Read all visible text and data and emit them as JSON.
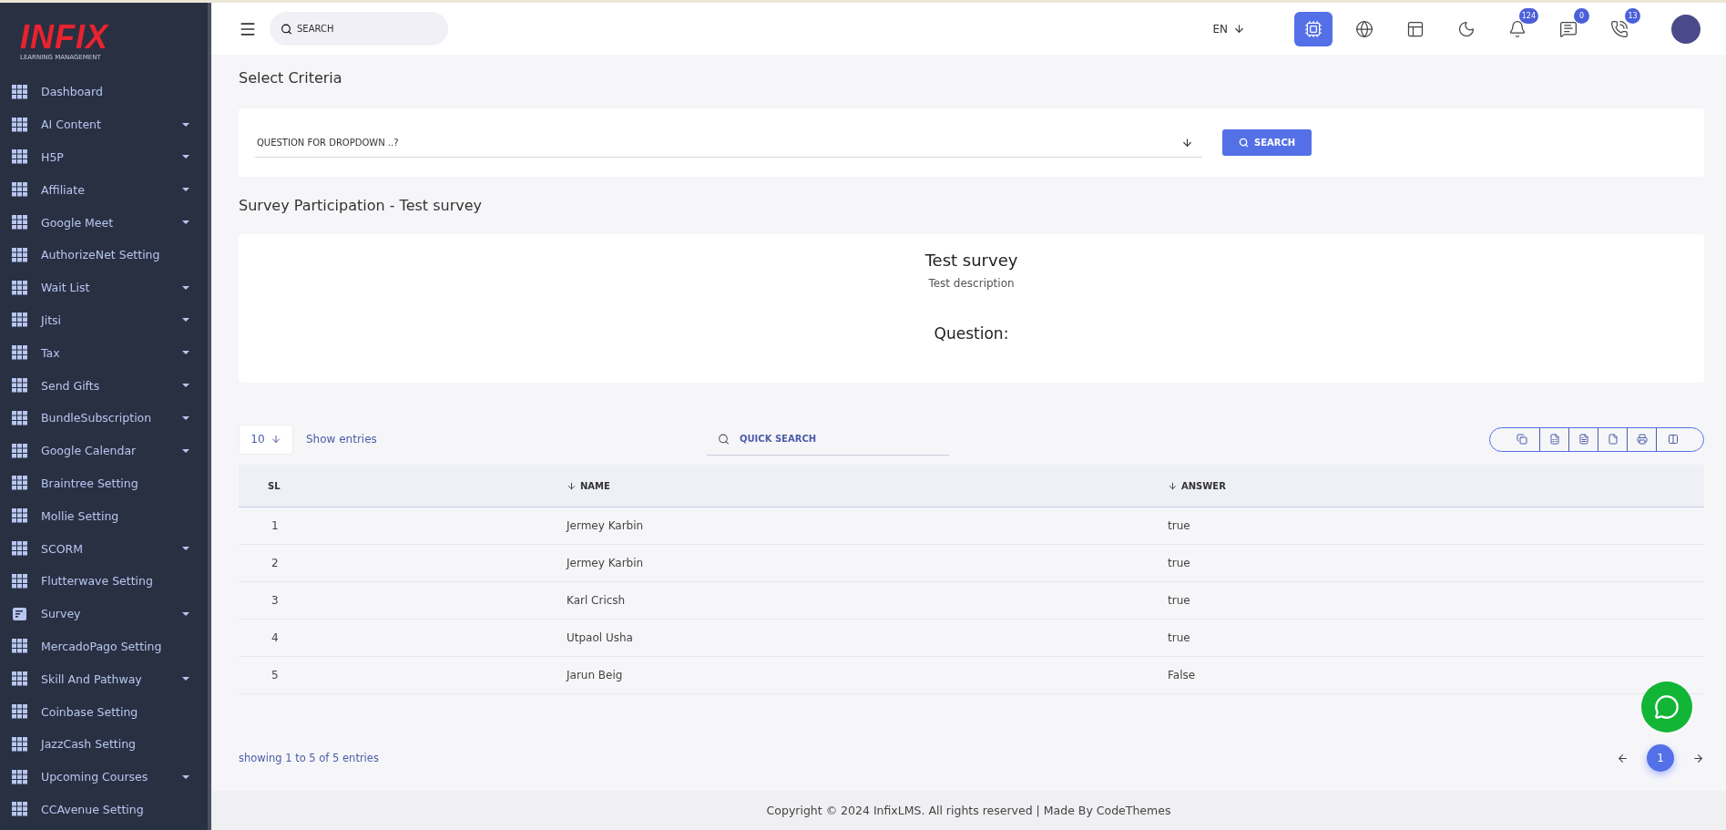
{
  "sidebar": {
    "logo": {
      "brand": "INFIX",
      "tagline": "LEARNING MANAGEMENT"
    },
    "items": [
      {
        "label": "Dashboard",
        "kind": "grid",
        "has_submenu": false
      },
      {
        "label": "AI Content",
        "kind": "grid",
        "has_submenu": true
      },
      {
        "label": "H5P",
        "kind": "grid",
        "has_submenu": true
      },
      {
        "label": "Affiliate",
        "kind": "grid",
        "has_submenu": true
      },
      {
        "label": "Google Meet",
        "kind": "grid",
        "has_submenu": true
      },
      {
        "label": "AuthorizeNet Setting",
        "kind": "grid",
        "has_submenu": false
      },
      {
        "label": "Wait List",
        "kind": "grid",
        "has_submenu": true
      },
      {
        "label": "Jitsi",
        "kind": "grid",
        "has_submenu": true
      },
      {
        "label": "Tax",
        "kind": "grid",
        "has_submenu": true
      },
      {
        "label": "Send Gifts",
        "kind": "grid",
        "has_submenu": true
      },
      {
        "label": "BundleSubscription",
        "kind": "grid",
        "has_submenu": true
      },
      {
        "label": "Google Calendar",
        "kind": "grid",
        "has_submenu": true
      },
      {
        "label": "Braintree Setting",
        "kind": "grid",
        "has_submenu": false
      },
      {
        "label": "Mollie Setting",
        "kind": "grid",
        "has_submenu": false
      },
      {
        "label": "SCORM",
        "kind": "grid",
        "has_submenu": true
      },
      {
        "label": "Flutterwave Setting",
        "kind": "grid",
        "has_submenu": false
      },
      {
        "label": "Survey",
        "kind": "document",
        "has_submenu": true
      },
      {
        "label": "MercadoPago Setting",
        "kind": "grid",
        "has_submenu": false
      },
      {
        "label": "Skill And Pathway",
        "kind": "grid",
        "has_submenu": true
      },
      {
        "label": "Coinbase Setting",
        "kind": "grid",
        "has_submenu": false
      },
      {
        "label": "JazzCash Setting",
        "kind": "grid",
        "has_submenu": false
      },
      {
        "label": "Upcoming Courses",
        "kind": "grid",
        "has_submenu": true
      },
      {
        "label": "CCAvenue Setting",
        "kind": "grid",
        "has_submenu": false
      }
    ]
  },
  "topbar": {
    "search": {
      "placeholder": "SEARCH"
    },
    "language": "EN",
    "icons": [
      {
        "kind": "chip"
      },
      {
        "kind": "globe"
      },
      {
        "kind": "layout"
      },
      {
        "kind": "moon"
      },
      {
        "kind": "bell",
        "badge": "124"
      },
      {
        "kind": "message",
        "badge": "0"
      },
      {
        "kind": "phone",
        "badge": "13"
      }
    ]
  },
  "criteria": {
    "title": "Select Criteria",
    "select": {
      "placeholder": "QUESTION FOR DROPDOWN ..?"
    },
    "button": "SEARCH"
  },
  "survey": {
    "title": "Survey Participation - Test survey",
    "name": "Test survey",
    "description": "Test description",
    "question_label": "Question:"
  },
  "table": {
    "page_size": "10",
    "show_entries": "Show entries",
    "search": {
      "placeholder": "QUICK SEARCH"
    },
    "export_buttons": [
      {
        "kind": "copy"
      },
      {
        "kind": "excel"
      },
      {
        "kind": "csv"
      },
      {
        "kind": "pdf"
      },
      {
        "kind": "print"
      },
      {
        "kind": "columns"
      }
    ],
    "columns": [
      {
        "label": "SL",
        "sortable": false
      },
      {
        "label": "NAME",
        "sortable": true
      },
      {
        "label": "ANSWER",
        "sortable": true
      }
    ],
    "rows": [
      {
        "sl": "1",
        "name": "Jermey Karbin",
        "answer": "true"
      },
      {
        "sl": "2",
        "name": "Jermey Karbin",
        "answer": "true"
      },
      {
        "sl": "3",
        "name": "Karl Cricsh",
        "answer": "true"
      },
      {
        "sl": "4",
        "name": "Utpaol Usha",
        "answer": "true"
      },
      {
        "sl": "5",
        "name": "Jarun Beig",
        "answer": "False"
      }
    ],
    "summary": "showing 1 to 5 of 5 entries",
    "pages": [
      {
        "label": "1",
        "selected": true
      }
    ]
  },
  "footer": "Copyright © 2024 InfixLMS. All rights reserved | Made By CodeThemes"
}
